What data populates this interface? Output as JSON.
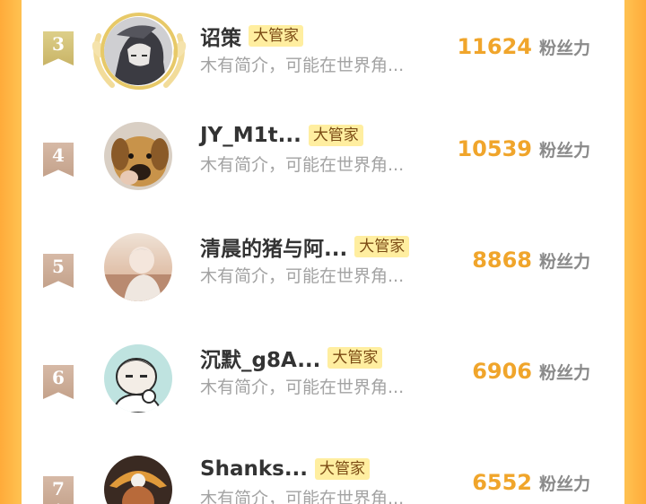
{
  "leaderboard": {
    "entries": [
      {
        "rank": "3",
        "name": "诏策",
        "badge": "大管家",
        "bio": "木有简介，可能在世界角...",
        "score": "11624",
        "unit": "粉丝力",
        "avatar": "knight-avatar-icon"
      },
      {
        "rank": "4",
        "name": "JY_M1t...",
        "badge": "大管家",
        "bio": "木有简介，可能在世界角...",
        "score": "10539",
        "unit": "粉丝力",
        "avatar": "dog-avatar-icon"
      },
      {
        "rank": "5",
        "name": "清晨的猪与阿...",
        "badge": "大管家",
        "bio": "木有简介，可能在世界角...",
        "score": "8868",
        "unit": "粉丝力",
        "avatar": "anime-boy-avatar-icon"
      },
      {
        "rank": "6",
        "name": "沉默_g8A...",
        "badge": "大管家",
        "bio": "木有简介，可能在世界角...",
        "score": "6906",
        "unit": "粉丝力",
        "avatar": "cartoon-boy-avatar-icon"
      },
      {
        "rank": "7",
        "name": "Shanks...",
        "badge": "大管家",
        "bio": "木有简介，可能在世界角...",
        "score": "6552",
        "unit": "粉丝力",
        "avatar": "pirate-avatar-icon"
      }
    ]
  },
  "colors": {
    "accent_orange": "#ffc04f",
    "score": "#f0a52b",
    "badge_bg": "#ffeea0",
    "rank_gold": "#d4c27a",
    "rank_bronze": "#cdad97"
  }
}
